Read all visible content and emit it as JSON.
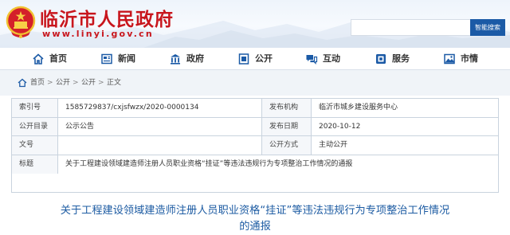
{
  "header": {
    "site_title": "临沂市人民政府",
    "site_url": "www.linyi.gov.cn",
    "search_placeholder": "",
    "search_button": "智能搜索",
    "brand_color": "#c8161d",
    "accent_color": "#1b5aa6"
  },
  "nav": {
    "items": [
      {
        "label": "首页",
        "icon": "home-icon"
      },
      {
        "label": "新闻",
        "icon": "newspaper-icon"
      },
      {
        "label": "政府",
        "icon": "government-building-icon"
      },
      {
        "label": "公开",
        "icon": "open-document-icon"
      },
      {
        "label": "互动",
        "icon": "chat-bubbles-icon"
      },
      {
        "label": "服务",
        "icon": "service-icon"
      },
      {
        "label": "市情",
        "icon": "city-icon"
      }
    ]
  },
  "breadcrumb": {
    "items": [
      "首页",
      "公开",
      "公开",
      "正文"
    ],
    "separator": ">"
  },
  "info": {
    "index_label": "索引号",
    "index_value": "1585729837/cxjsfwzx/2020-0000134",
    "publisher_label": "发布机构",
    "publisher_value": "临沂市城乡建设服务中心",
    "catalog_label": "公开目录",
    "catalog_value": "公示公告",
    "date_label": "发布日期",
    "date_value": "2020-10-12",
    "docno_label": "文号",
    "docno_value": "",
    "method_label": "公开方式",
    "method_value": "主动公开",
    "title_label": "标题",
    "title_value": "关于工程建设领域建造师注册人员职业资格“挂证”等违法违规行为专项整治工作情况的通报"
  },
  "article": {
    "title_line1": "关于工程建设领域建造师注册人员职业资格“挂证”等违法违规行为专项整治工作情况",
    "title_line2": "的通报"
  }
}
